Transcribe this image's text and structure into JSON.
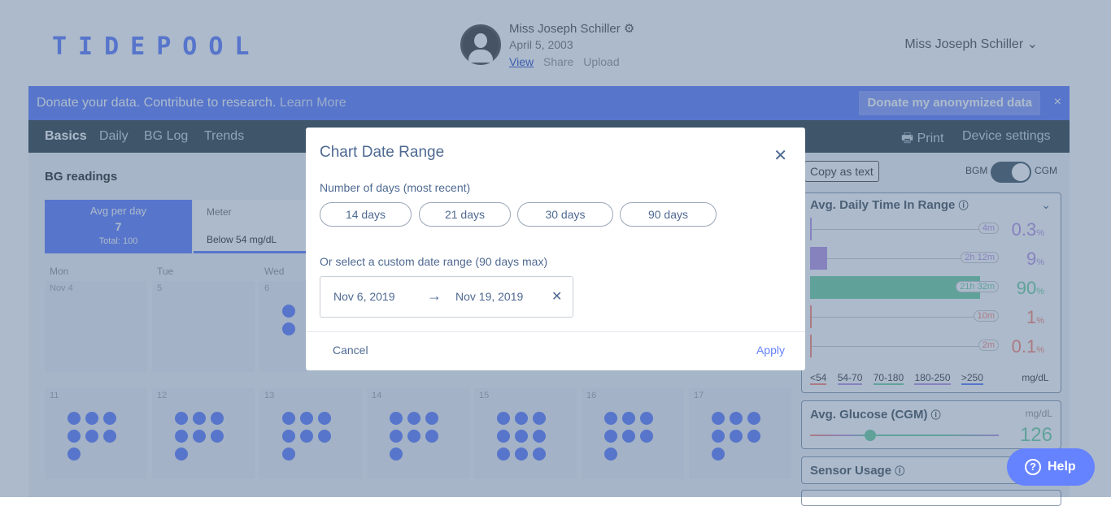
{
  "header": {
    "logo": "TIDEPOOL",
    "patient_name": "Miss Joseph Schiller",
    "patient_dob": "April 5, 2003",
    "links": [
      "View",
      "Share",
      "Upload"
    ],
    "user_menu": "Miss Joseph Schiller ⌄"
  },
  "banner": {
    "text": "Donate your data. Contribute to research.",
    "learn_more": "Learn More",
    "donate_button": "Donate my anonymized data",
    "close": "×"
  },
  "tabs": {
    "basics": "Basics",
    "daily": "Daily",
    "bglog": "BG Log",
    "trends": "Trends",
    "print": "Print",
    "device_settings": "Device settings"
  },
  "basics": {
    "title": "BG readings",
    "avg_label": "Avg per day",
    "avg_value": "7",
    "avg_total": "Total: 100",
    "meter_label": "Meter",
    "meter_filter": "Below 54 mg/dL",
    "weekdays": [
      "Mon",
      "Tue",
      "Wed"
    ],
    "week1": [
      "Nov 4",
      "5",
      "6"
    ],
    "week2": [
      "11",
      "12",
      "13",
      "14",
      "15",
      "16",
      "17"
    ]
  },
  "sidebar": {
    "copy_text": "Copy as text",
    "toggle_left": "BGM",
    "toggle_right": "CGM",
    "tir_title": "Avg. Daily Time In Range",
    "tir_rows": [
      {
        "time": "4m",
        "pct": "0.3",
        "color": "#bb9ae7",
        "fraction": 0.003
      },
      {
        "time": "2h 12m",
        "pct": "9",
        "color": "#bb9ae7",
        "fraction": 0.09
      },
      {
        "time": "21h 32m",
        "pct": "90",
        "color": "#76d3a6",
        "fraction": 0.9
      },
      {
        "time": "10m",
        "pct": "1",
        "color": "#ff8b7c",
        "fraction": 0.01
      },
      {
        "time": "2m",
        "pct": "0.1",
        "color": "#ff8b7c",
        "fraction": 0.001
      }
    ],
    "tir_legend": [
      "<54",
      "54-70",
      "70-180",
      "180-250",
      ">250"
    ],
    "tir_unit": "mg/dL",
    "glucose_title": "Avg. Glucose (CGM)",
    "glucose_unit": "mg/dL",
    "glucose_value": "126",
    "sensor_title": "Sensor Usage"
  },
  "modal": {
    "title": "Chart Date Range",
    "days_label": "Number of days (most recent)",
    "day_buttons": [
      "14 days",
      "21 days",
      "30 days",
      "90 days"
    ],
    "custom_label": "Or select a custom date range (90 days max)",
    "start_date": "Nov 6, 2019",
    "arrow": "→",
    "end_date": "Nov 19, 2019",
    "clear": "✕",
    "cancel": "Cancel",
    "apply": "Apply",
    "close": "✕"
  },
  "help": {
    "label": "Help",
    "icon": "?"
  }
}
